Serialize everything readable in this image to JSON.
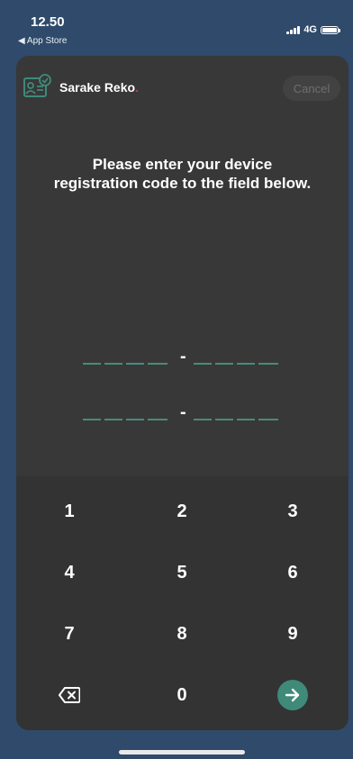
{
  "status_bar": {
    "time": "12.50",
    "back_label": "◀ App Store",
    "network": "4G"
  },
  "header": {
    "app_name": "Sarake Reko",
    "brand_dot": ".",
    "cancel_label": "Cancel"
  },
  "instruction": {
    "line1": "Please enter your device",
    "line2": "registration code to the field below."
  },
  "code_fields": {
    "separator": "-"
  },
  "keypad": {
    "k1": "1",
    "k2": "2",
    "k3": "3",
    "k4": "4",
    "k5": "5",
    "k6": "6",
    "k7": "7",
    "k8": "8",
    "k9": "9",
    "k0": "0"
  },
  "colors": {
    "page_bg": "#2f4a6a",
    "modal_bg": "#383838",
    "accent": "#3f8a78",
    "brand_dot": "#d33a3a"
  },
  "icons": {
    "backspace": "backspace-icon",
    "submit": "arrow-right-icon",
    "logo": "id-card-icon"
  }
}
